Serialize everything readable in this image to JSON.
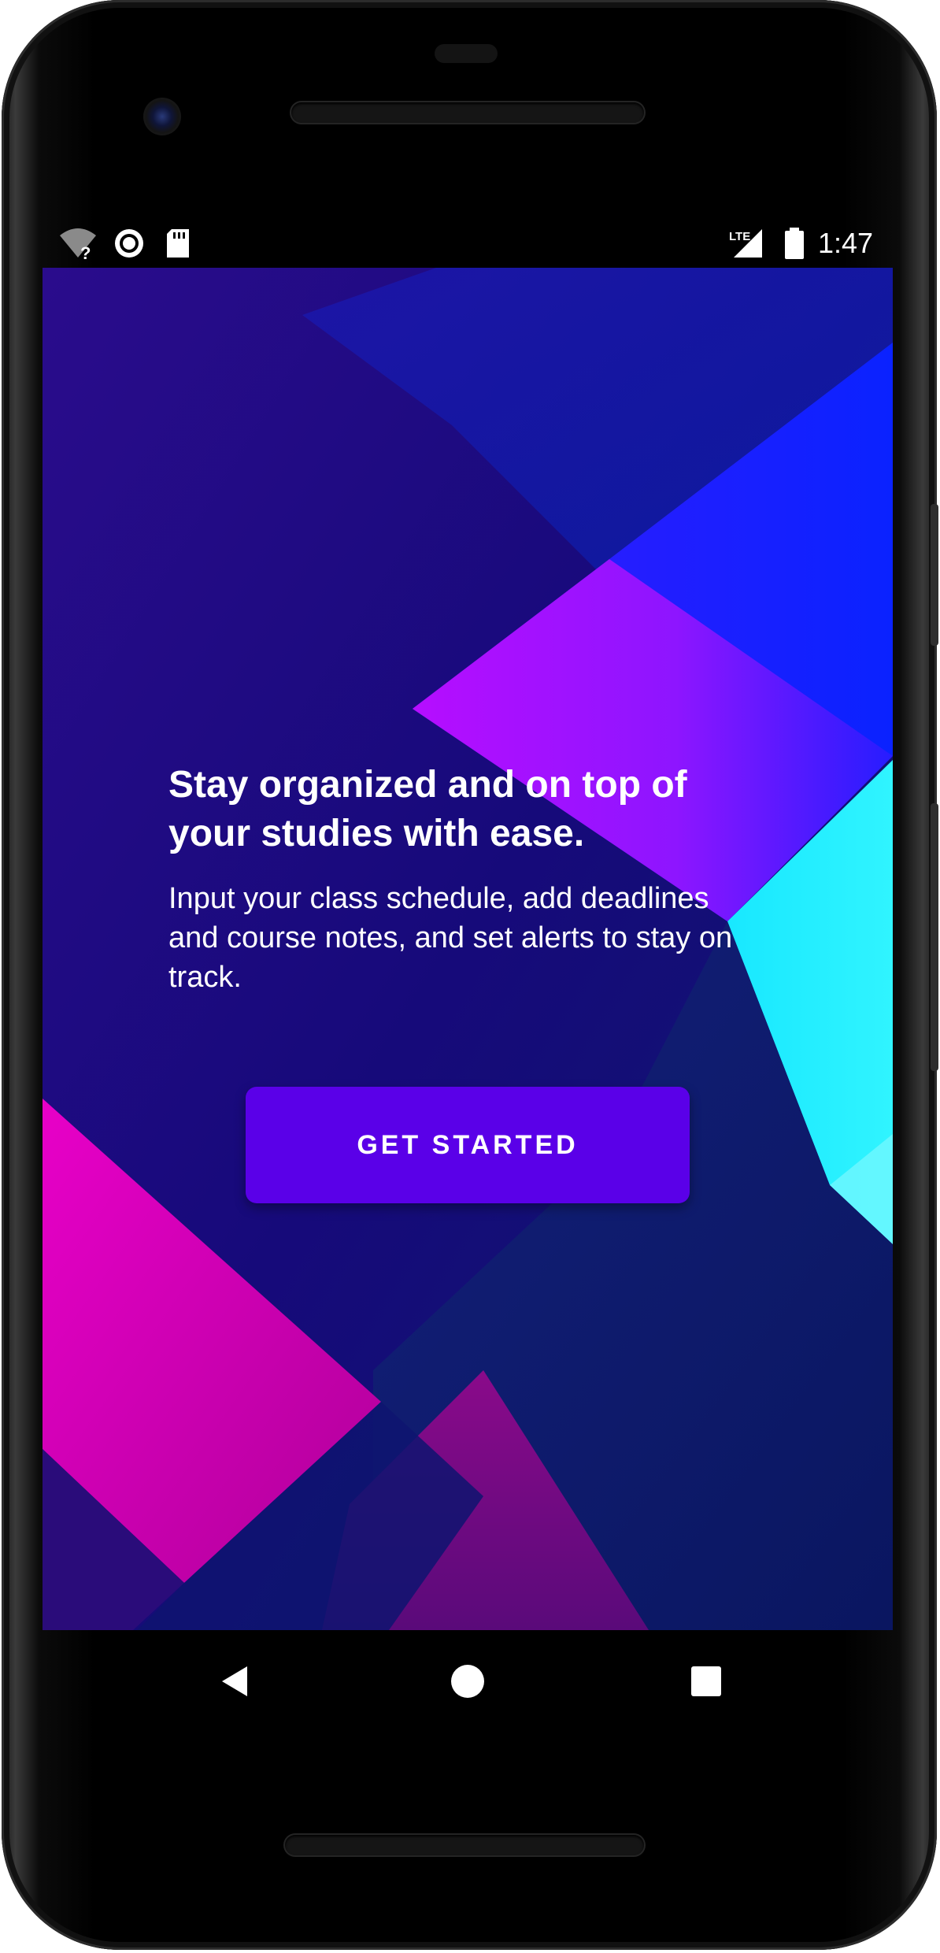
{
  "status_bar": {
    "time": "1:47",
    "icons": [
      "wifi-question-icon",
      "circle-record-icon",
      "sd-card-icon",
      "lte-signal-icon",
      "battery-full-icon"
    ],
    "lte_label": "LTE"
  },
  "onboarding": {
    "headline": "Stay organized and on top of your studies with ease.",
    "description": "Input your class schedule, add deadlines and course notes, and set alerts to stay on track.",
    "cta_label": "GET STARTED",
    "cta_color": "#5a00e8"
  },
  "nav_bar": {
    "buttons": [
      "back-icon",
      "home-icon",
      "recents-icon"
    ]
  },
  "colors": {
    "background_deep": "#1a0a8a",
    "magenta": "#e000c8",
    "violet": "#c810ff",
    "cyan": "#20f0ff"
  }
}
